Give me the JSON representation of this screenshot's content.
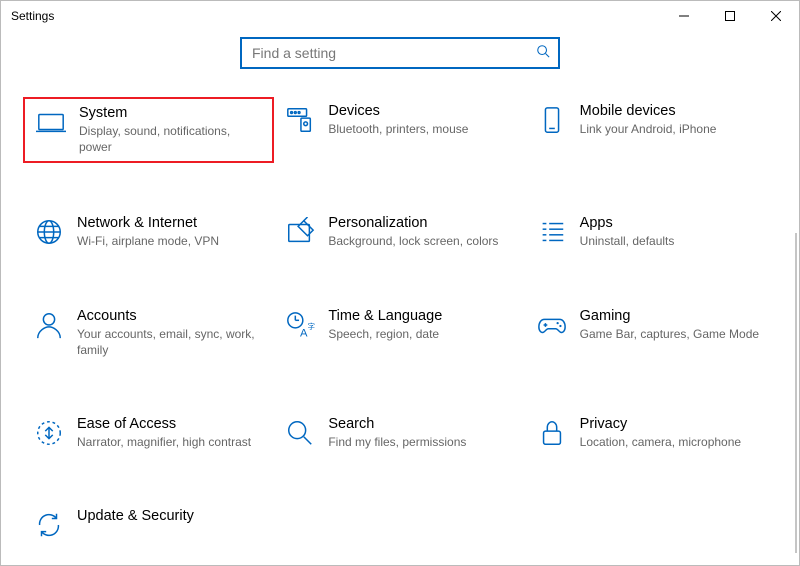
{
  "window": {
    "title": "Settings"
  },
  "search": {
    "placeholder": "Find a setting"
  },
  "categories": {
    "system": {
      "title": "System",
      "desc": "Display, sound, notifications, power"
    },
    "devices": {
      "title": "Devices",
      "desc": "Bluetooth, printers, mouse"
    },
    "mobile": {
      "title": "Mobile devices",
      "desc": "Link your Android, iPhone"
    },
    "network": {
      "title": "Network & Internet",
      "desc": "Wi-Fi, airplane mode, VPN"
    },
    "personalization": {
      "title": "Personalization",
      "desc": "Background, lock screen, colors"
    },
    "apps": {
      "title": "Apps",
      "desc": "Uninstall, defaults"
    },
    "accounts": {
      "title": "Accounts",
      "desc": "Your accounts, email, sync, work, family"
    },
    "time": {
      "title": "Time & Language",
      "desc": "Speech, region, date"
    },
    "gaming": {
      "title": "Gaming",
      "desc": "Game Bar, captures, Game Mode"
    },
    "ease": {
      "title": "Ease of Access",
      "desc": "Narrator, magnifier, high contrast"
    },
    "searchcat": {
      "title": "Search",
      "desc": "Find my files, permissions"
    },
    "privacy": {
      "title": "Privacy",
      "desc": "Location, camera, microphone"
    },
    "update": {
      "title": "Update & Security",
      "desc": ""
    }
  }
}
